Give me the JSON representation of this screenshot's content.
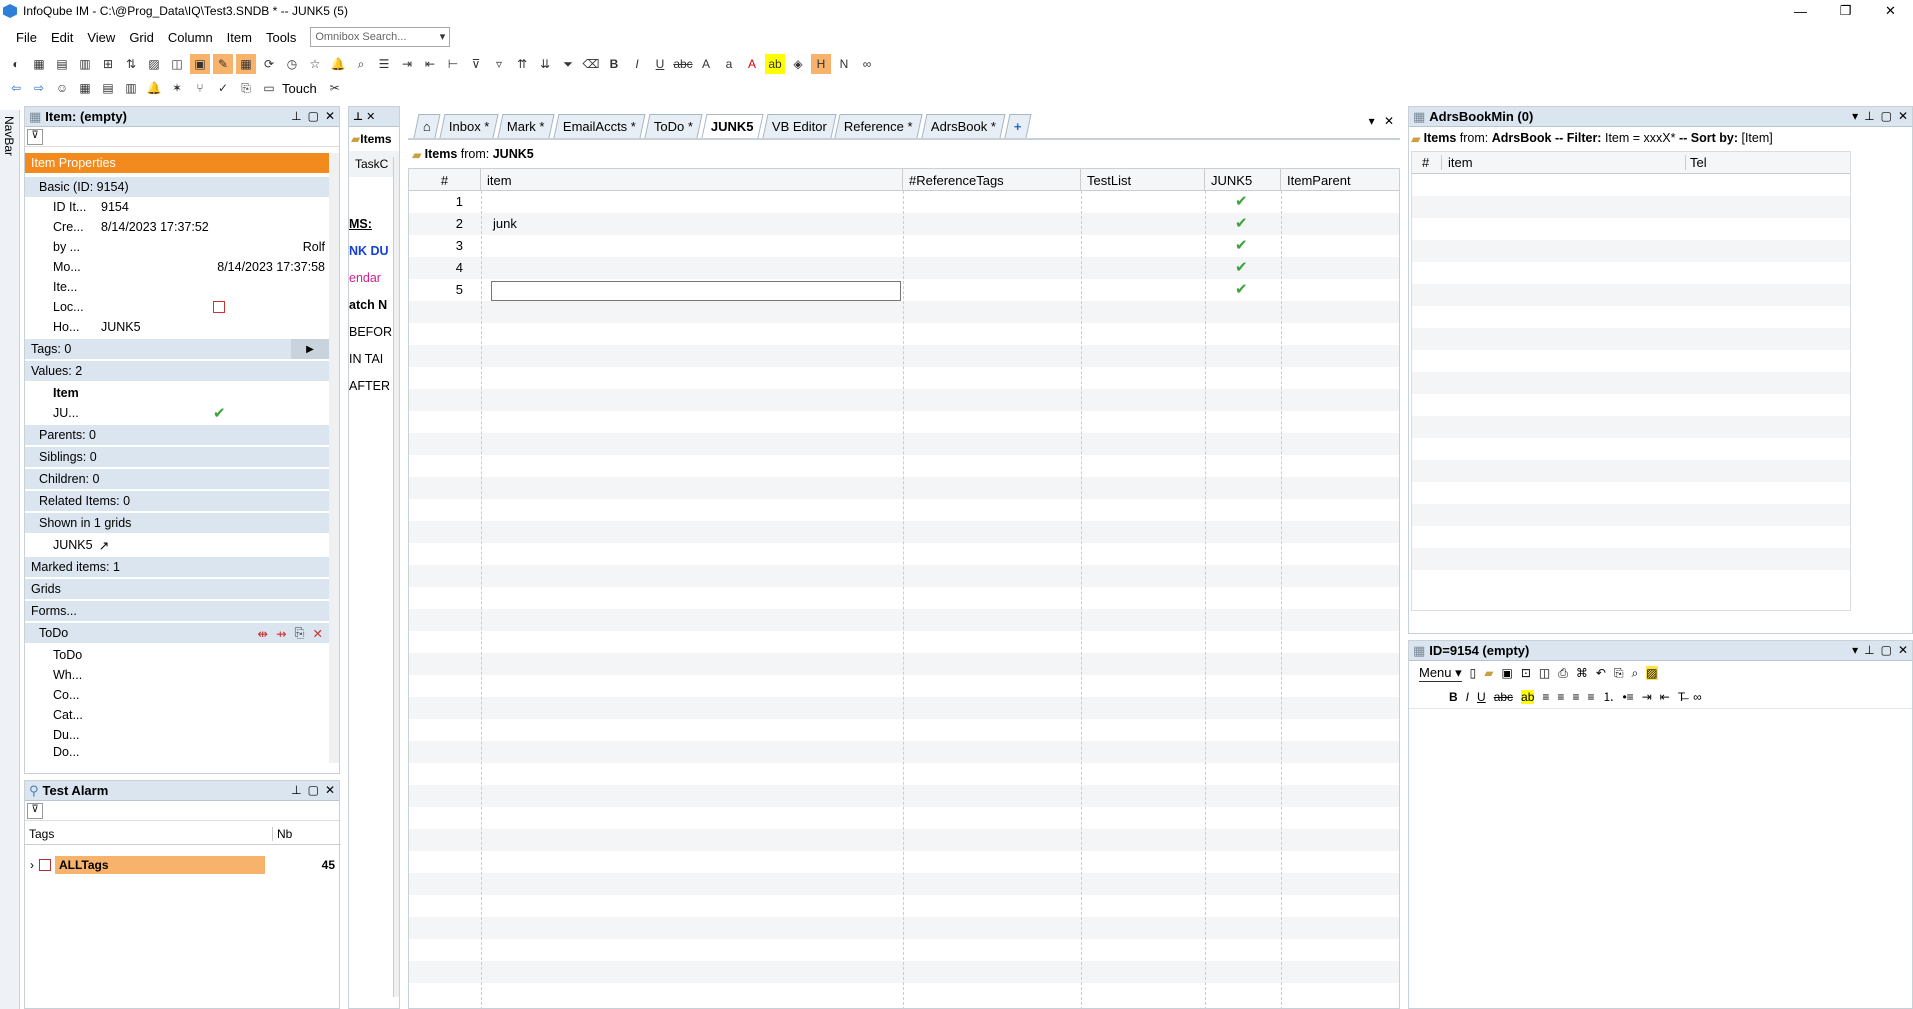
{
  "title": "InfoQube IM - C:\\@Prog_Data\\IQ\\Test3.SNDB * -- JUNK5 (5)",
  "menu": [
    "File",
    "Edit",
    "View",
    "Grid",
    "Column",
    "Item",
    "Tools"
  ],
  "omnibox_placeholder": "Omnibox Search...",
  "toolbar2_touch": "Touch",
  "navbar_label": "NavBar",
  "item_panel": {
    "title": "Item: (empty)",
    "item_properties": "Item Properties",
    "basic": "Basic (ID: 9154)",
    "props": [
      {
        "k": "ID It...",
        "v": "9154"
      },
      {
        "k": "Cre...",
        "v": "8/14/2023 17:37:52"
      },
      {
        "k": "by ...",
        "v": "Rolf"
      },
      {
        "k": "Mo...",
        "v": "8/14/2023 17:37:58"
      },
      {
        "k": "Ite...",
        "v": ""
      },
      {
        "k": "Loc...",
        "v": ""
      },
      {
        "k": "Ho...",
        "v": "JUNK5"
      }
    ],
    "tags": "Tags: 0",
    "values": "Values: 2",
    "values_item": "Item",
    "values_ju": "JU...",
    "parents": "Parents: 0",
    "siblings": "Siblings: 0",
    "children": "Children: 0",
    "related": "Related Items: 0",
    "shown": "Shown in 1 grids",
    "shown_grid": "JUNK5",
    "marked": "Marked items: 1",
    "grids": "Grids",
    "forms": "Forms...",
    "todo": "ToDo",
    "todo_fields": [
      "ToDo",
      "Wh...",
      "Co...",
      "Cat...",
      "Du...",
      "Do..."
    ]
  },
  "alarm_panel": {
    "title": "Test Alarm",
    "col_tags": "Tags",
    "col_nb": "Nb",
    "row_label": "ALLTags",
    "row_nb": "45"
  },
  "mid_panel": {
    "items": "Items",
    "taskc": "TaskC",
    "snips": [
      "MS:",
      "NK DU",
      "endar",
      "atch N",
      "BEFOR",
      "IN TAI",
      "AFTER"
    ]
  },
  "tabs": [
    "Inbox *",
    "Mark *",
    "EmailAccts *",
    "ToDo *",
    "JUNK5",
    "VB Editor",
    "Reference *",
    "AdrsBook *"
  ],
  "active_tab": "JUNK5",
  "grid": {
    "source_prefix": "Items",
    "source_label": "from:",
    "source_name": "JUNK5",
    "columns": [
      "#",
      "item",
      "#ReferenceTags",
      "TestList",
      "JUNK5",
      "ItemParent"
    ],
    "rows": [
      {
        "n": "1",
        "item": "",
        "junk5": "✔"
      },
      {
        "n": "2",
        "item": "junk",
        "junk5": "✔"
      },
      {
        "n": "3",
        "item": "",
        "junk5": "✔"
      },
      {
        "n": "4",
        "item": "",
        "junk5": "✔"
      },
      {
        "n": "5",
        "item": "",
        "junk5": "✔"
      }
    ]
  },
  "adrs_panel": {
    "title": "AdrsBookMin (0)",
    "subtitle_prefix": "Items",
    "subtitle_from": "from:",
    "subtitle_name": "AdrsBook",
    "subtitle_filter": "-- Filter:",
    "subtitle_filter_val": "Item = xxxX*",
    "subtitle_sort": "-- Sort by:",
    "subtitle_sort_val": "[Item]",
    "columns": [
      "#",
      "item",
      "Tel"
    ]
  },
  "editor_panel": {
    "title": "ID=9154 (empty)",
    "menu": "Menu"
  },
  "colors": {
    "accent": "#f28a1d",
    "header": "#dbe5ef",
    "check": "#3aa33a",
    "selected_row": "#f7b26b"
  }
}
